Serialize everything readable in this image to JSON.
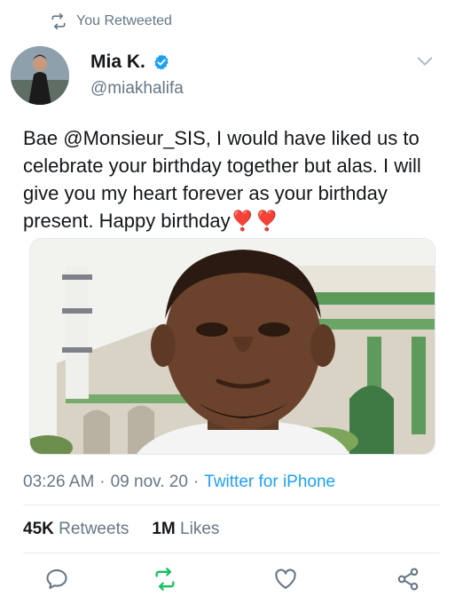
{
  "retweet_banner": {
    "label": "You Retweeted",
    "icon": "retweet-icon"
  },
  "author": {
    "display_name": "Mia K.",
    "handle": "@miakhalifa",
    "verified": true
  },
  "tweet": {
    "text_prefix": "Bae ",
    "mention": "@Monsieur_SIS",
    "text_suffix": ", I would have liked us to celebrate your birthday together but alas.  I will give you my heart forever as your birthday present.  Happy birthday",
    "emoji": "❣️❣️"
  },
  "meta": {
    "time": "03:26 AM",
    "date": "09 nov. 20",
    "separator": "·",
    "source": "Twitter for iPhone"
  },
  "stats": {
    "retweets_count": "45K",
    "retweets_label": "Retweets",
    "likes_count": "1M",
    "likes_label": "Likes"
  },
  "actions": {
    "reply_icon": "reply-icon",
    "retweet_icon": "retweet-icon",
    "like_icon": "heart-icon",
    "share_icon": "share-icon",
    "retweeted": true
  },
  "colors": {
    "accent": "#1da1f2",
    "retweet_active": "#17bf63",
    "muted": "#657786"
  }
}
